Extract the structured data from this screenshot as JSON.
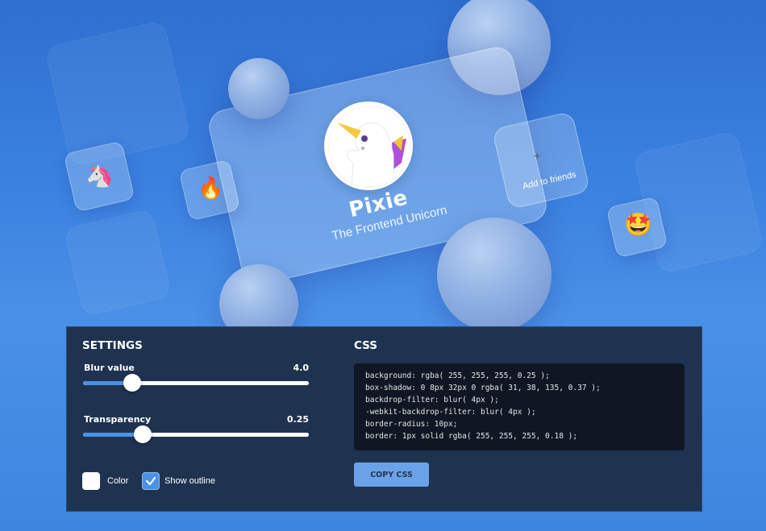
{
  "card": {
    "name": "Pixie",
    "subtitle": "The Frontend Unicorn",
    "add_label": "Add to friends",
    "add_plus": "+"
  },
  "emojis": {
    "unicorn": "🦄",
    "fire": "🔥",
    "star_struck": "🤩"
  },
  "settings": {
    "title": "SETTINGS",
    "blur": {
      "label": "Blur value",
      "value": "4.0",
      "level": 0.22
    },
    "transparency": {
      "label": "Transparency",
      "value": "0.25",
      "level": 0.26
    },
    "color_label": "Color",
    "outline_label": "Show outline",
    "outline_checked": true
  },
  "css": {
    "title": "CSS",
    "lines": [
      "background: rgba( 255, 255, 255, 0.25 );",
      "box-shadow: 0 8px 32px 0 rgba( 31, 38, 135, 0.37 );",
      "backdrop-filter: blur( 4px );",
      "-webkit-backdrop-filter: blur( 4px );",
      "border-radius: 10px;",
      "border: 1px solid rgba( 255, 255, 255, 0.18 );"
    ],
    "copy_label": "COPY CSS"
  },
  "colors": {
    "accent": "#4b92e6",
    "panel_bg": "#1f3350",
    "code_bg": "#0f1724"
  }
}
